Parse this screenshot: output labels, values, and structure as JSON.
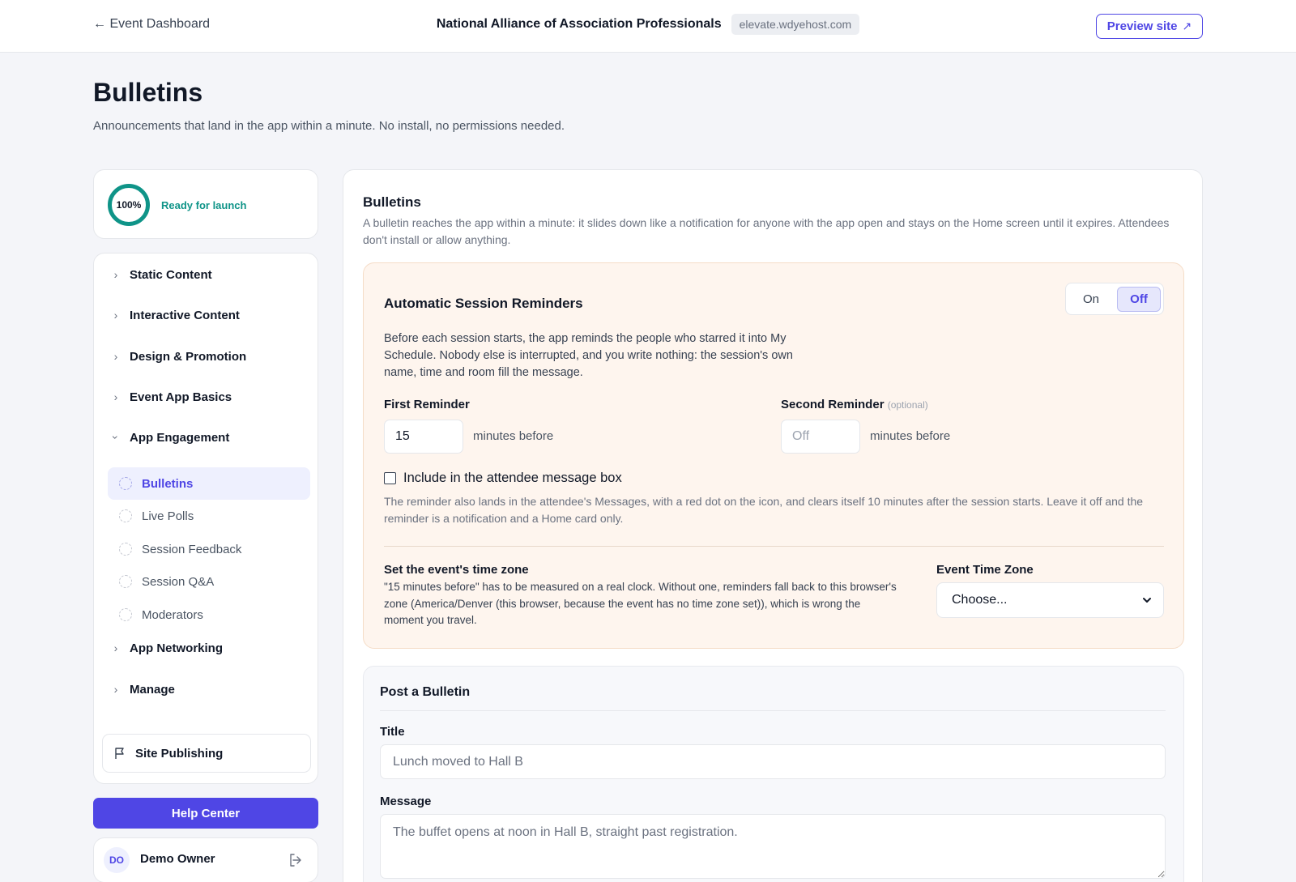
{
  "header": {
    "back_label": "← Event Dashboard",
    "org_name": "National Alliance of Association Professionals",
    "host": "elevate.wdyehost.com",
    "preview_label": "Preview site",
    "preview_icon": "↗"
  },
  "page": {
    "title": "Bulletins",
    "subtitle": "Announcements that land in the app within a minute. No install, no permissions needed."
  },
  "launch": {
    "percent": "100%",
    "progress": 1.0,
    "label": "Ready for launch",
    "color": "#0f9488"
  },
  "nav": {
    "sections": [
      {
        "label": "Static Content",
        "expanded": false
      },
      {
        "label": "Interactive Content",
        "expanded": false
      },
      {
        "label": "Design & Promotion",
        "expanded": false
      },
      {
        "label": "Event App Basics",
        "expanded": false
      },
      {
        "label": "App Engagement",
        "expanded": true
      },
      {
        "label": "App Networking",
        "expanded": false
      },
      {
        "label": "Manage",
        "expanded": false
      }
    ],
    "engagement_items": [
      {
        "label": "Bulletins",
        "active": true
      },
      {
        "label": "Live Polls",
        "active": false
      },
      {
        "label": "Session Feedback",
        "active": false
      },
      {
        "label": "Session Q&A",
        "active": false
      },
      {
        "label": "Moderators",
        "active": false
      }
    ],
    "publishing_label": "Site Publishing"
  },
  "help_label": "Help Center",
  "user": {
    "initials": "DO",
    "name": "Demo Owner"
  },
  "bulletins": {
    "title": "Bulletins",
    "description": "A bulletin reaches the app within a minute: it slides down like a notification for anyone with the app open and stays on the Home screen until it expires. Attendees don't install or allow anything."
  },
  "reminders": {
    "title": "Automatic Session Reminders",
    "toggle_on": "On",
    "toggle_off": "Off",
    "selected": "Off",
    "description": "Before each session starts, the app reminds the people who starred it into My Schedule. Nobody else is interrupted, and you write nothing: the session's own name, time and room fill the message.",
    "first_label": "First Reminder",
    "first_value": "15",
    "second_label": "Second Reminder",
    "second_optional": "(optional)",
    "second_placeholder": "Off",
    "unit": "minutes before",
    "include_label": "Include in the attendee message box",
    "include_checked": false,
    "include_desc": "The reminder also lands in the attendee's Messages, with a red dot on the icon, and clears itself 10 minutes after the session starts. Leave it off and the reminder is a notification and a Home card only.",
    "tz_title": "Set the event's time zone",
    "tz_desc": "\"15 minutes before\" has to be measured on a real clock. Without one, reminders fall back to this browser's zone (America/Denver (this browser, because the event has no time zone set)), which is wrong the moment you travel.",
    "tz_label": "Event Time Zone",
    "tz_selected": "Choose..."
  },
  "post": {
    "title": "Post a Bulletin",
    "title_label": "Title",
    "title_placeholder": "Lunch moved to Hall B",
    "message_label": "Message",
    "message_placeholder": "The buffet opens at noon in Hall B, straight past registration."
  },
  "colors": {
    "accent": "#4f46e5",
    "success": "#0f9488",
    "reminder_bg": "#fef5ee"
  }
}
